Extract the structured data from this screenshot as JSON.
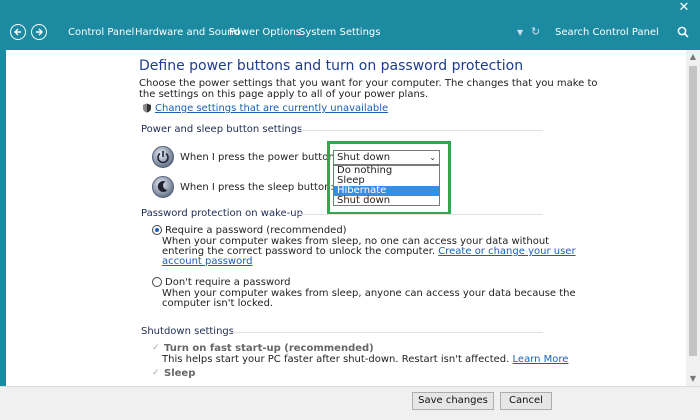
{
  "window": {
    "close_glyph": "✕"
  },
  "address": {
    "breadcrumbs": [
      "Control Panel",
      "Hardware and Sound",
      "Power Options",
      "System Settings"
    ],
    "search_placeholder": "Search Control Panel"
  },
  "page": {
    "title": "Define power buttons and turn on password protection",
    "intro_line1": "Choose the power settings that you want for your computer. The changes that you make to",
    "intro_line2": "the settings on this page apply to all of your power plans.",
    "change_unavailable": "Change settings that are currently unavailable"
  },
  "power_section": {
    "title": "Power and sleep button settings",
    "power_label": "When I press the power button:",
    "sleep_label": "When I press the sleep button:",
    "selected_value": "Shut down",
    "options": [
      "Do nothing",
      "Sleep",
      "Hibernate",
      "Shut down"
    ],
    "highlighted_option": "Hibernate"
  },
  "password_section": {
    "title": "Password protection on wake-up",
    "require_label": "Require a password (recommended)",
    "require_desc1": "When your computer wakes from sleep, no one can access your data without",
    "require_desc2": "entering the correct password to unlock the computer.",
    "require_link1": "Create or change your user",
    "require_link2": "account password",
    "no_require_label": "Don't require a password",
    "no_require_desc1": "When your computer wakes from sleep, anyone can access your data because the",
    "no_require_desc2": "computer isn't locked."
  },
  "shutdown_section": {
    "title": "Shutdown settings",
    "fast_startup_label": "Turn on fast start-up (recommended)",
    "fast_startup_desc": "This helps start your PC faster after shut-down. Restart isn't affected.",
    "learn_more": "Learn More",
    "sleep_label": "Sleep"
  },
  "footer": {
    "save": "Save changes",
    "cancel": "Cancel"
  },
  "colors": {
    "accent": "#1c8aa0",
    "heading": "#1e3d8c",
    "link": "#1a5fb4",
    "highlight_box": "#2fa84f",
    "selection": "#3390ea"
  }
}
